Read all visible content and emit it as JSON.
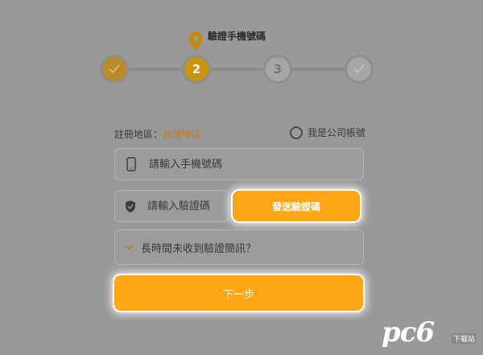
{
  "stepper": {
    "caption": "驗證手機號碼",
    "steps": [
      {
        "state": "done",
        "label": "✓"
      },
      {
        "state": "current",
        "label": "2"
      },
      {
        "state": "todo",
        "label": "3"
      },
      {
        "state": "todo",
        "label": "✓"
      }
    ]
  },
  "form": {
    "region_label": "註冊地區：",
    "region_value": "台灣地區",
    "company_account_label": "我是公司帳號",
    "phone_placeholder": "請輸入手機號碼",
    "code_placeholder": "請輸入驗證碼",
    "send_code_label": "發送驗證碼",
    "help_text": "長時間未收到驗證簡訊？",
    "next_label": "下一步"
  },
  "watermark": {
    "brand": "pc6",
    "sub": "下载站"
  },
  "colors": {
    "background": "#999999",
    "accent": "#ffa516",
    "region_value": "#c67d16"
  }
}
